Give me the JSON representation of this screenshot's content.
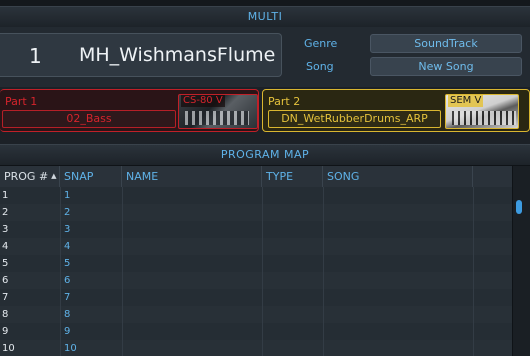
{
  "multi": {
    "header": "MULTI",
    "number": "1",
    "name": "MH_WishmansFlume",
    "genre_label": "Genre",
    "genre_value": "SoundTrack",
    "song_label": "Song",
    "song_value": "New Song"
  },
  "part1": {
    "label": "Part 1",
    "preset": "02_Bass",
    "instrument": "CS-80 V"
  },
  "part2": {
    "label": "Part 2",
    "preset": "DN_WetRubberDrums_ARP",
    "instrument": "SEM V"
  },
  "program_map": {
    "header": "PROGRAM MAP",
    "columns": [
      "PROG #",
      "SNAP",
      "NAME",
      "TYPE",
      "SONG"
    ],
    "rows": [
      {
        "prog": "1",
        "snap": "1"
      },
      {
        "prog": "2",
        "snap": "2"
      },
      {
        "prog": "3",
        "snap": "3"
      },
      {
        "prog": "4",
        "snap": "4"
      },
      {
        "prog": "5",
        "snap": "5"
      },
      {
        "prog": "6",
        "snap": "6"
      },
      {
        "prog": "7",
        "snap": "7"
      },
      {
        "prog": "8",
        "snap": "8"
      },
      {
        "prog": "9",
        "snap": "9"
      },
      {
        "prog": "10",
        "snap": "10"
      }
    ]
  },
  "colors": {
    "accent": "#5fb2e8",
    "part1": "#d5242c",
    "part2": "#e4c23c"
  }
}
